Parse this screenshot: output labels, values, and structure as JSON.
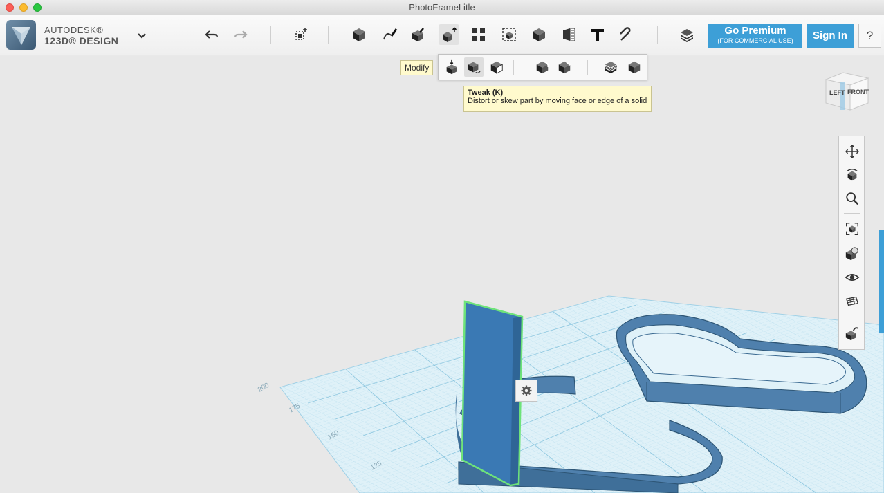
{
  "window": {
    "title": "PhotoFrameLitle"
  },
  "brand": {
    "line1": "AUTODESK®",
    "line2": "123D® DESIGN"
  },
  "toolbar": {
    "tools": [
      {
        "name": "undo",
        "icon": "undo-icon"
      },
      {
        "name": "redo",
        "icon": "redo-icon"
      },
      {
        "name": "transform",
        "icon": "transform-icon"
      },
      {
        "name": "primitives",
        "icon": "primitives-icon"
      },
      {
        "name": "sketch",
        "icon": "sketch-icon"
      },
      {
        "name": "construct",
        "icon": "construct-icon"
      },
      {
        "name": "modify",
        "icon": "modify-icon"
      },
      {
        "name": "pattern",
        "icon": "pattern-icon"
      },
      {
        "name": "grouping",
        "icon": "grouping-icon"
      },
      {
        "name": "combine",
        "icon": "combine-icon"
      },
      {
        "name": "measure",
        "icon": "measure-icon"
      },
      {
        "name": "text",
        "icon": "text-icon"
      },
      {
        "name": "snap",
        "icon": "snap-icon"
      },
      {
        "name": "materials",
        "icon": "materials-icon"
      }
    ],
    "premium": {
      "title": "Go Premium",
      "subtitle": "(FOR COMMERCIAL USE)"
    },
    "signin_label": "Sign In",
    "help_label": "?"
  },
  "tooltips": {
    "modify": "Modify",
    "tweak": {
      "title": "Tweak (K)",
      "description": "Distort or skew part by moving face or edge of a solid"
    }
  },
  "modify_submenu": {
    "items": [
      {
        "name": "press-pull",
        "icon": "press-pull-icon"
      },
      {
        "name": "tweak",
        "icon": "tweak-icon",
        "active": true
      },
      {
        "name": "split-face",
        "icon": "split-face-icon"
      },
      {
        "name": "fillet",
        "icon": "fillet-icon"
      },
      {
        "name": "chamfer",
        "icon": "chamfer-icon"
      },
      {
        "name": "split-solid",
        "icon": "split-solid-icon"
      },
      {
        "name": "shell",
        "icon": "shell-icon"
      }
    ]
  },
  "viewcube": {
    "left_label": "LEFT",
    "front_label": "FRONT"
  },
  "navbar": {
    "items": [
      {
        "name": "pan",
        "icon": "pan-icon"
      },
      {
        "name": "orbit",
        "icon": "orbit-icon"
      },
      {
        "name": "zoom",
        "icon": "zoom-icon"
      },
      {
        "name": "fit",
        "icon": "fit-icon"
      },
      {
        "name": "solid-view",
        "icon": "solid-view-icon"
      },
      {
        "name": "visibility",
        "icon": "eye-icon"
      },
      {
        "name": "grid",
        "icon": "grid-icon"
      },
      {
        "name": "material",
        "icon": "material-icon"
      }
    ]
  },
  "grid_labels": [
    "200",
    "175",
    "150",
    "125"
  ],
  "colors": {
    "accent": "#3d9fd7",
    "model": "#4f80ad",
    "selection": "#6ee37a",
    "grid": "#bfe2f0"
  }
}
